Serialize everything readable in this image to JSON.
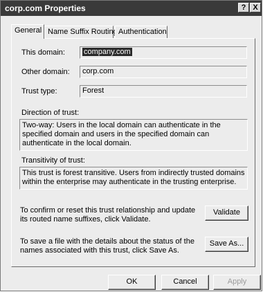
{
  "window": {
    "title": "corp.com Properties",
    "help_label": "?",
    "close_label": "X"
  },
  "tabs": [
    {
      "label": "General"
    },
    {
      "label": "Name Suffix Routing"
    },
    {
      "label": "Authentication"
    }
  ],
  "general": {
    "this_domain_label": "This domain:",
    "this_domain_value": "company.com",
    "other_domain_label": "Other domain:",
    "other_domain_value": "corp.com",
    "trust_type_label": "Trust type:",
    "trust_type_value": "Forest",
    "direction_label": "Direction of trust:",
    "direction_text": "Two-way: Users in the local domain can authenticate in the specified domain and users in the specified domain can authenticate in the local domain.",
    "transitivity_label": "Transitivity of trust:",
    "transitivity_text": "This trust is forest transitive.  Users from indirectly trusted domains within the enterprise may authenticate in the trusting enterprise.",
    "validate_text": "To confirm or reset this trust relationship and update its routed name suffixes, click Validate.",
    "validate_button": "Validate",
    "saveas_text": "To save a file with the details about the status of the names associated with this trust, click Save As.",
    "saveas_button": "Save As..."
  },
  "footer": {
    "ok": "OK",
    "cancel": "Cancel",
    "apply": "Apply"
  }
}
